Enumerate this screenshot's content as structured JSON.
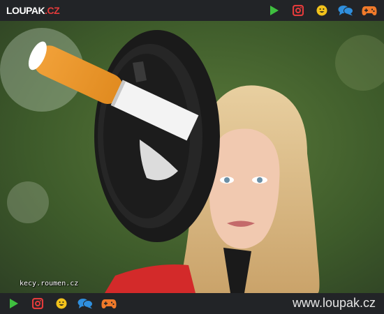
{
  "header": {
    "logo_word": "LOUPAK",
    "logo_tld": ".CZ",
    "icons": [
      "play-icon",
      "instagram-icon",
      "smiley-icon",
      "chat-icon",
      "gamepad-icon"
    ]
  },
  "photo": {
    "watermark": "kecy.roumen.cz"
  },
  "footer": {
    "icons": [
      "play-icon",
      "instagram-icon",
      "smiley-icon",
      "chat-icon",
      "gamepad-icon"
    ],
    "site_url": "www.loupak.cz"
  },
  "colors": {
    "bar_bg": "#222427",
    "play": "#3fbf3f",
    "instagram": "#e33b3b",
    "smiley": "#f2c21b",
    "chat": "#2f8fde",
    "gamepad": "#f07a2a"
  }
}
